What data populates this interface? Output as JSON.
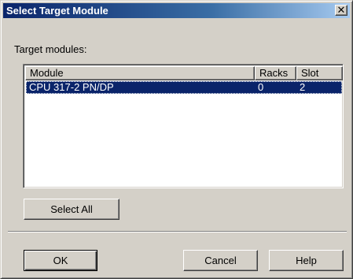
{
  "window": {
    "title": "Select Target Module"
  },
  "target_modules_label": "Target modules:",
  "table": {
    "columns": [
      "Module",
      "Racks",
      "Slot"
    ],
    "rows": [
      {
        "module": "CPU 317-2 PN/DP",
        "racks": "0",
        "slot": "2",
        "selected": true
      }
    ]
  },
  "buttons": {
    "select_all": "Select All",
    "ok": "OK",
    "cancel": "Cancel",
    "help": "Help"
  },
  "colors": {
    "dialog_face": "#d4d0c8",
    "titlebar_active": "#0a246a",
    "selection": "#0a246a"
  },
  "icons": {
    "close": "close-icon"
  }
}
